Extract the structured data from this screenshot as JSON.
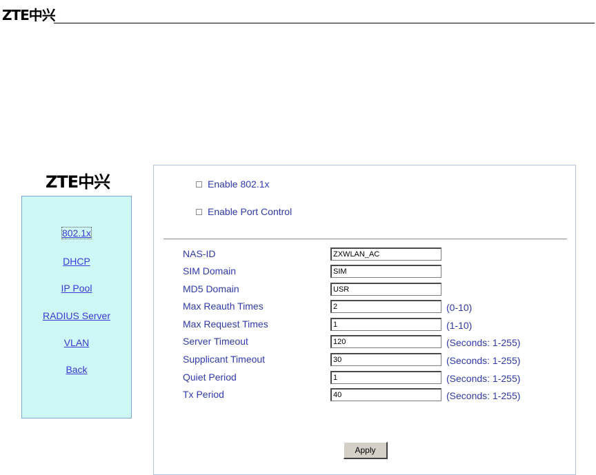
{
  "header": {
    "logo_text": "ZTE中兴"
  },
  "nav": {
    "logo_text": "ZTE中兴",
    "items": [
      {
        "label": "802.1x"
      },
      {
        "label": "DHCP"
      },
      {
        "label": "IP Pool"
      },
      {
        "label": "RADIUS Server"
      },
      {
        "label": "VLAN"
      },
      {
        "label": "Back"
      }
    ]
  },
  "form": {
    "enable_8021x": {
      "label": "Enable 802.1x",
      "checked": false
    },
    "enable_port_control": {
      "label": "Enable Port Control",
      "checked": false
    },
    "fields": [
      {
        "label": "NAS-ID",
        "value": "ZXWLAN_AC",
        "hint": ""
      },
      {
        "label": "SIM Domain",
        "value": "SIM",
        "hint": ""
      },
      {
        "label": "MD5 Domain",
        "value": "USR",
        "hint": ""
      },
      {
        "label": "Max Reauth Times",
        "value": "2",
        "hint": "(0-10)"
      },
      {
        "label": "Max Request Times",
        "value": "1",
        "hint": "(1-10)"
      },
      {
        "label": "Server Timeout",
        "value": "120",
        "hint": "(Seconds: 1-255)"
      },
      {
        "label": "Supplicant Timeout",
        "value": "30",
        "hint": "(Seconds: 1-255)"
      },
      {
        "label": "Quiet Period",
        "value": "1",
        "hint": "(Seconds: 1-255)"
      },
      {
        "label": "Tx Period",
        "value": "40",
        "hint": "(Seconds: 1-255)"
      }
    ],
    "apply_label": "Apply"
  }
}
